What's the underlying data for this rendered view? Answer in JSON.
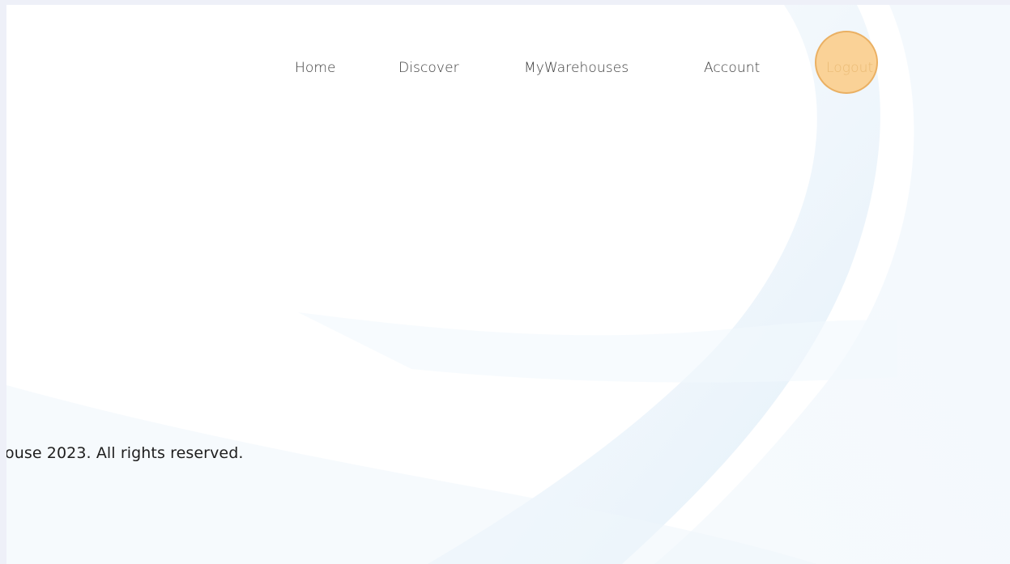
{
  "nav": {
    "items": [
      {
        "id": "home",
        "label": "Home"
      },
      {
        "id": "discover",
        "label": "Discover"
      },
      {
        "id": "warehouses",
        "label": "MyWarehouses"
      },
      {
        "id": "account",
        "label": "Account"
      },
      {
        "id": "logout",
        "label": "Logout"
      }
    ]
  },
  "footer": {
    "copyright": "ouse 2023. All rights reserved."
  },
  "colors": {
    "page_background": "#ffffff",
    "frame_background": "#eef0f8",
    "nav_text": "#3a3a3a",
    "logout_text": "#b7a57f",
    "click_marker": "#fdc470",
    "wave_tint": "#dcebf7"
  }
}
